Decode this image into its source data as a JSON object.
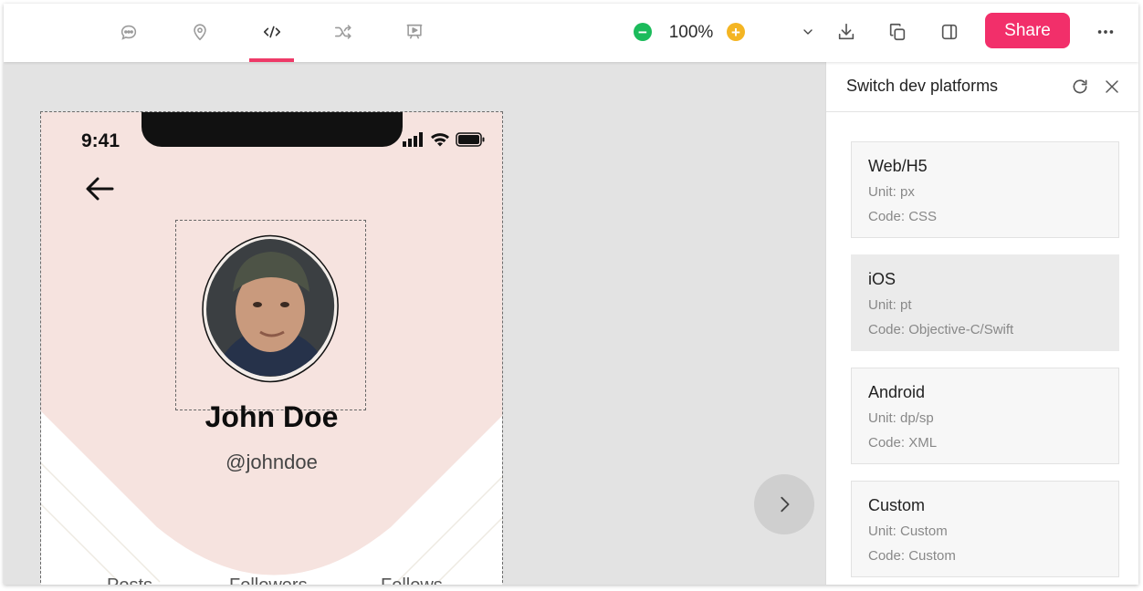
{
  "toolbar": {
    "tools": [
      {
        "icon": "comment-icon",
        "active": false
      },
      {
        "icon": "location-pin-icon",
        "active": false
      },
      {
        "icon": "code-icon",
        "active": true
      },
      {
        "icon": "shuffle-icon",
        "active": false
      },
      {
        "icon": "presentation-icon",
        "active": false
      }
    ],
    "zoom_level": "100%",
    "share_label": "Share",
    "accent_color": "#f22f6a"
  },
  "phone": {
    "time": "9:41",
    "name": "John Doe",
    "handle": "@johndoe",
    "stats": [
      "Posts",
      "Followers",
      "Follows"
    ],
    "header_color": "#f6e3df"
  },
  "panel": {
    "title": "Switch dev platforms",
    "platforms": [
      {
        "name": "Web/H5",
        "unit": "Unit: px",
        "code": "Code: CSS",
        "selected": false
      },
      {
        "name": "iOS",
        "unit": "Unit: pt",
        "code": "Code: Objective-C/Swift",
        "selected": true
      },
      {
        "name": "Android",
        "unit": "Unit: dp/sp",
        "code": "Code: XML",
        "selected": false
      },
      {
        "name": "Custom",
        "unit": "Unit: Custom",
        "code": "Code: Custom",
        "selected": false
      }
    ]
  }
}
